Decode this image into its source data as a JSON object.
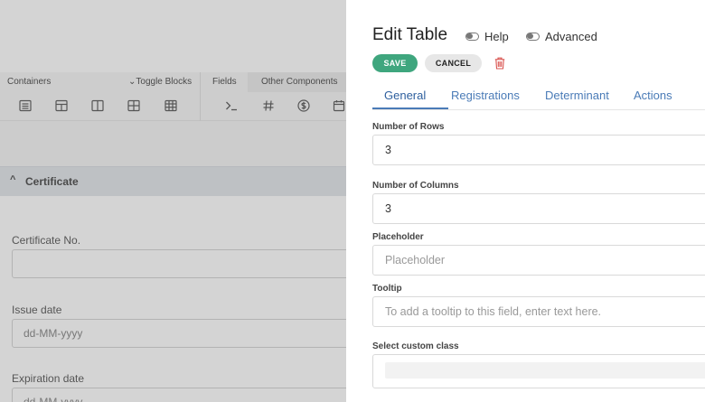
{
  "builder": {
    "toolbar": {
      "containers_label": "Containers",
      "toggle_blocks_label": "Toggle Blocks",
      "fields_label": "Fields",
      "other_components_label": "Other Components"
    },
    "section": {
      "title": "Certificate"
    },
    "fields": [
      {
        "label": "Certificate No.",
        "value": ""
      },
      {
        "label": "Issue date",
        "placeholder": "dd-MM-yyyy"
      },
      {
        "label": "Expiration date",
        "placeholder": "dd-MM-yyyy"
      }
    ]
  },
  "panel": {
    "title": "Edit Table",
    "help_label": "Help",
    "advanced_label": "Advanced",
    "save_label": "SAVE",
    "cancel_label": "CANCEL",
    "tabs": [
      {
        "label": "General",
        "active": true
      },
      {
        "label": "Registrations",
        "active": false
      },
      {
        "label": "Determinant",
        "active": false
      },
      {
        "label": "Actions",
        "active": false
      }
    ],
    "form": {
      "rows_label": "Number of Rows",
      "rows_value": "3",
      "columns_label": "Number of Columns",
      "columns_value": "3",
      "placeholder_label": "Placeholder",
      "placeholder_placeholder": "Placeholder",
      "tooltip_label": "Tooltip",
      "tooltip_placeholder": "To add a tooltip to this field, enter text here.",
      "custom_class_label": "Select custom class"
    }
  },
  "colors": {
    "save_button": "#3fa67e",
    "tab_active": "#2e5f9e",
    "tab_link": "#4a7bb7",
    "delete_icon": "#d9534f"
  },
  "icons": [
    "list-icon",
    "table-grid-icon",
    "columns-icon",
    "grid-icon",
    "table-icon",
    "terminal-icon",
    "hash-icon",
    "currency-icon",
    "calendar-icon",
    "trash-icon",
    "caret-up-icon",
    "caret-down-icon"
  ]
}
